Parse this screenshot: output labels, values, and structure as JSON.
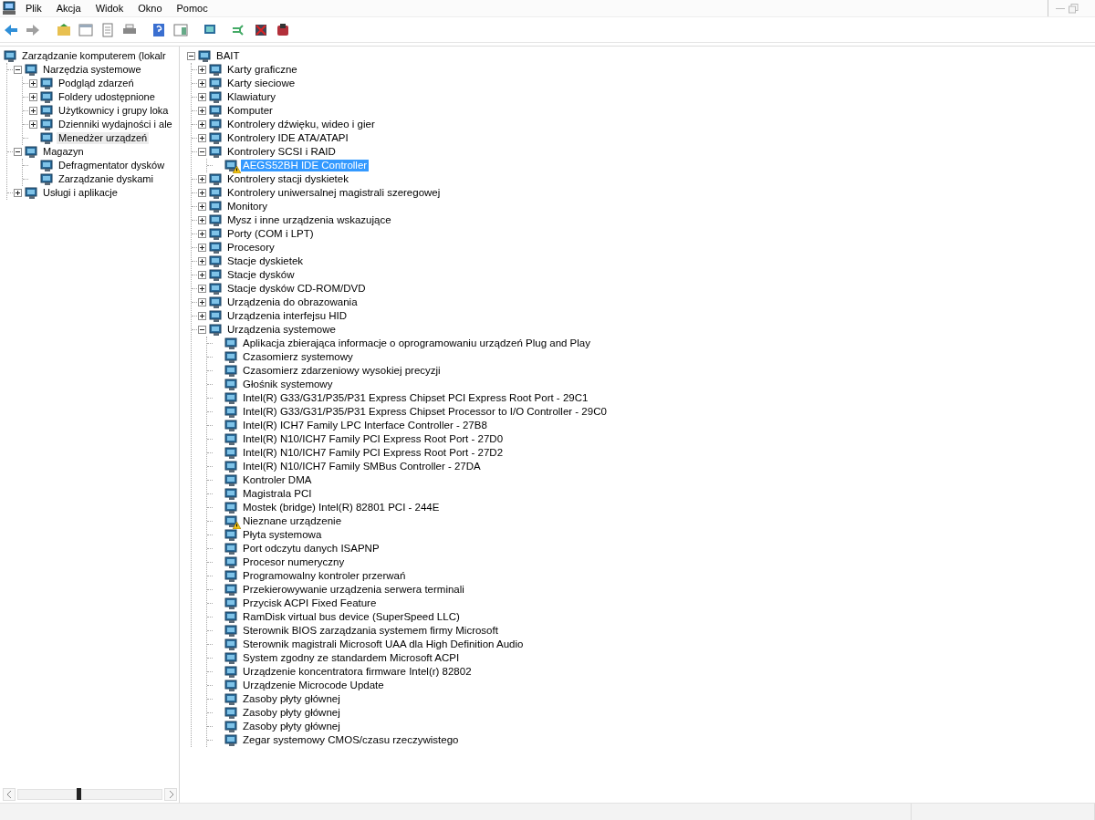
{
  "menu": [
    "Plik",
    "Akcja",
    "Widok",
    "Okno",
    "Pomoc"
  ],
  "left_tree": {
    "label": "Zarządzanie komputerem (lokalr",
    "selected": false,
    "children": [
      {
        "label": "Narzędzia systemowe",
        "selected": false,
        "expanded": true,
        "children": [
          {
            "label": "Podgląd zdarzeń",
            "selected": false,
            "expanded": false
          },
          {
            "label": "Foldery udostępnione",
            "selected": false,
            "expanded": false
          },
          {
            "label": "Użytkownicy i grupy loka",
            "selected": false,
            "expanded": false
          },
          {
            "label": "Dzienniki wydajności i ale",
            "selected": false,
            "expanded": false
          },
          {
            "label": "Menedżer urządzeń",
            "selected": true
          }
        ]
      },
      {
        "label": "Magazyn",
        "selected": false,
        "expanded": true,
        "children": [
          {
            "label": "Defragmentator dysków",
            "selected": false
          },
          {
            "label": "Zarządzanie dyskami",
            "selected": false
          }
        ]
      },
      {
        "label": "Usługi i aplikacje",
        "selected": false,
        "expanded": false
      }
    ]
  },
  "right_tree": {
    "label": "BAIT",
    "selected": false,
    "expanded": true,
    "children": [
      {
        "label": "Karty graficzne",
        "selected": false,
        "expanded": false
      },
      {
        "label": "Karty sieciowe",
        "selected": false,
        "expanded": false
      },
      {
        "label": "Klawiatury",
        "selected": false,
        "expanded": false
      },
      {
        "label": "Komputer",
        "selected": false,
        "expanded": false
      },
      {
        "label": "Kontrolery dźwięku, wideo i gier",
        "selected": false,
        "expanded": false
      },
      {
        "label": "Kontrolery IDE ATA/ATAPI",
        "selected": false,
        "expanded": false
      },
      {
        "label": "Kontrolery SCSI i RAID",
        "selected": false,
        "expanded": true,
        "children": [
          {
            "label": "AEGS52BH IDE Controller",
            "selected": true,
            "warning": true
          }
        ]
      },
      {
        "label": "Kontrolery stacji dyskietek",
        "selected": false,
        "expanded": false
      },
      {
        "label": "Kontrolery uniwersalnej magistrali szeregowej",
        "selected": false,
        "expanded": false
      },
      {
        "label": "Monitory",
        "selected": false,
        "expanded": false
      },
      {
        "label": "Mysz i inne urządzenia wskazujące",
        "selected": false,
        "expanded": false
      },
      {
        "label": "Porty (COM i LPT)",
        "selected": false,
        "expanded": false
      },
      {
        "label": "Procesory",
        "selected": false,
        "expanded": false
      },
      {
        "label": "Stacje dyskietek",
        "selected": false,
        "expanded": false
      },
      {
        "label": "Stacje dysków",
        "selected": false,
        "expanded": false
      },
      {
        "label": "Stacje dysków CD-ROM/DVD",
        "selected": false,
        "expanded": false
      },
      {
        "label": "Urządzenia do obrazowania",
        "selected": false,
        "expanded": false
      },
      {
        "label": "Urządzenia interfejsu HID",
        "selected": false,
        "expanded": false
      },
      {
        "label": "Urządzenia systemowe",
        "selected": false,
        "expanded": true,
        "children": [
          {
            "label": "Aplikacja zbierająca informacje o oprogramowaniu urządzeń Plug and Play",
            "selected": false,
            "warning": false
          },
          {
            "label": "Czasomierz systemowy",
            "selected": false,
            "warning": false
          },
          {
            "label": "Czasomierz zdarzeniowy wysokiej precyzji",
            "selected": false,
            "warning": false
          },
          {
            "label": "Głośnik systemowy",
            "selected": false,
            "warning": false
          },
          {
            "label": "Intel(R) G33/G31/P35/P31 Express Chipset PCI Express Root Port - 29C1",
            "selected": false,
            "warning": false
          },
          {
            "label": "Intel(R) G33/G31/P35/P31 Express Chipset Processor to I/O Controller - 29C0",
            "selected": false,
            "warning": false
          },
          {
            "label": "Intel(R) ICH7 Family LPC Interface Controller - 27B8",
            "selected": false,
            "warning": false
          },
          {
            "label": "Intel(R) N10/ICH7 Family PCI Express Root Port - 27D0",
            "selected": false,
            "warning": false
          },
          {
            "label": "Intel(R) N10/ICH7 Family PCI Express Root Port - 27D2",
            "selected": false,
            "warning": false
          },
          {
            "label": "Intel(R) N10/ICH7 Family SMBus Controller - 27DA",
            "selected": false,
            "warning": false
          },
          {
            "label": "Kontroler DMA",
            "selected": false,
            "warning": false
          },
          {
            "label": "Magistrala PCI",
            "selected": false,
            "warning": false
          },
          {
            "label": "Mostek (bridge) Intel(R) 82801 PCI - 244E",
            "selected": false,
            "warning": false
          },
          {
            "label": "Nieznane urządzenie",
            "selected": false,
            "warning": true
          },
          {
            "label": "Płyta systemowa",
            "selected": false,
            "warning": false
          },
          {
            "label": "Port odczytu danych ISAPNP",
            "selected": false,
            "warning": false
          },
          {
            "label": "Procesor numeryczny",
            "selected": false,
            "warning": false
          },
          {
            "label": "Programowalny kontroler przerwań",
            "selected": false,
            "warning": false
          },
          {
            "label": "Przekierowywanie urządzenia serwera terminali",
            "selected": false,
            "warning": false
          },
          {
            "label": "Przycisk ACPI Fixed Feature",
            "selected": false,
            "warning": false
          },
          {
            "label": "RamDisk virtual bus device (SuperSpeed LLC)",
            "selected": false,
            "warning": false
          },
          {
            "label": "Sterownik BIOS zarządzania systemem firmy Microsoft",
            "selected": false,
            "warning": false
          },
          {
            "label": "Sterownik magistrali Microsoft UAA dla High Definition Audio",
            "selected": false,
            "warning": false
          },
          {
            "label": "System zgodny ze standardem Microsoft ACPI",
            "selected": false,
            "warning": false
          },
          {
            "label": "Urządzenie koncentratora firmware Intel(r) 82802",
            "selected": false,
            "warning": false
          },
          {
            "label": "Urządzenie Microcode Update",
            "selected": false,
            "warning": false
          },
          {
            "label": "Zasoby płyty głównej",
            "selected": false,
            "warning": false
          },
          {
            "label": "Zasoby płyty głównej",
            "selected": false,
            "warning": false
          },
          {
            "label": "Zasoby płyty głównej",
            "selected": false,
            "warning": false
          },
          {
            "label": "Zegar systemowy CMOS/czasu rzeczywistego",
            "selected": false,
            "warning": false
          }
        ]
      }
    ]
  }
}
